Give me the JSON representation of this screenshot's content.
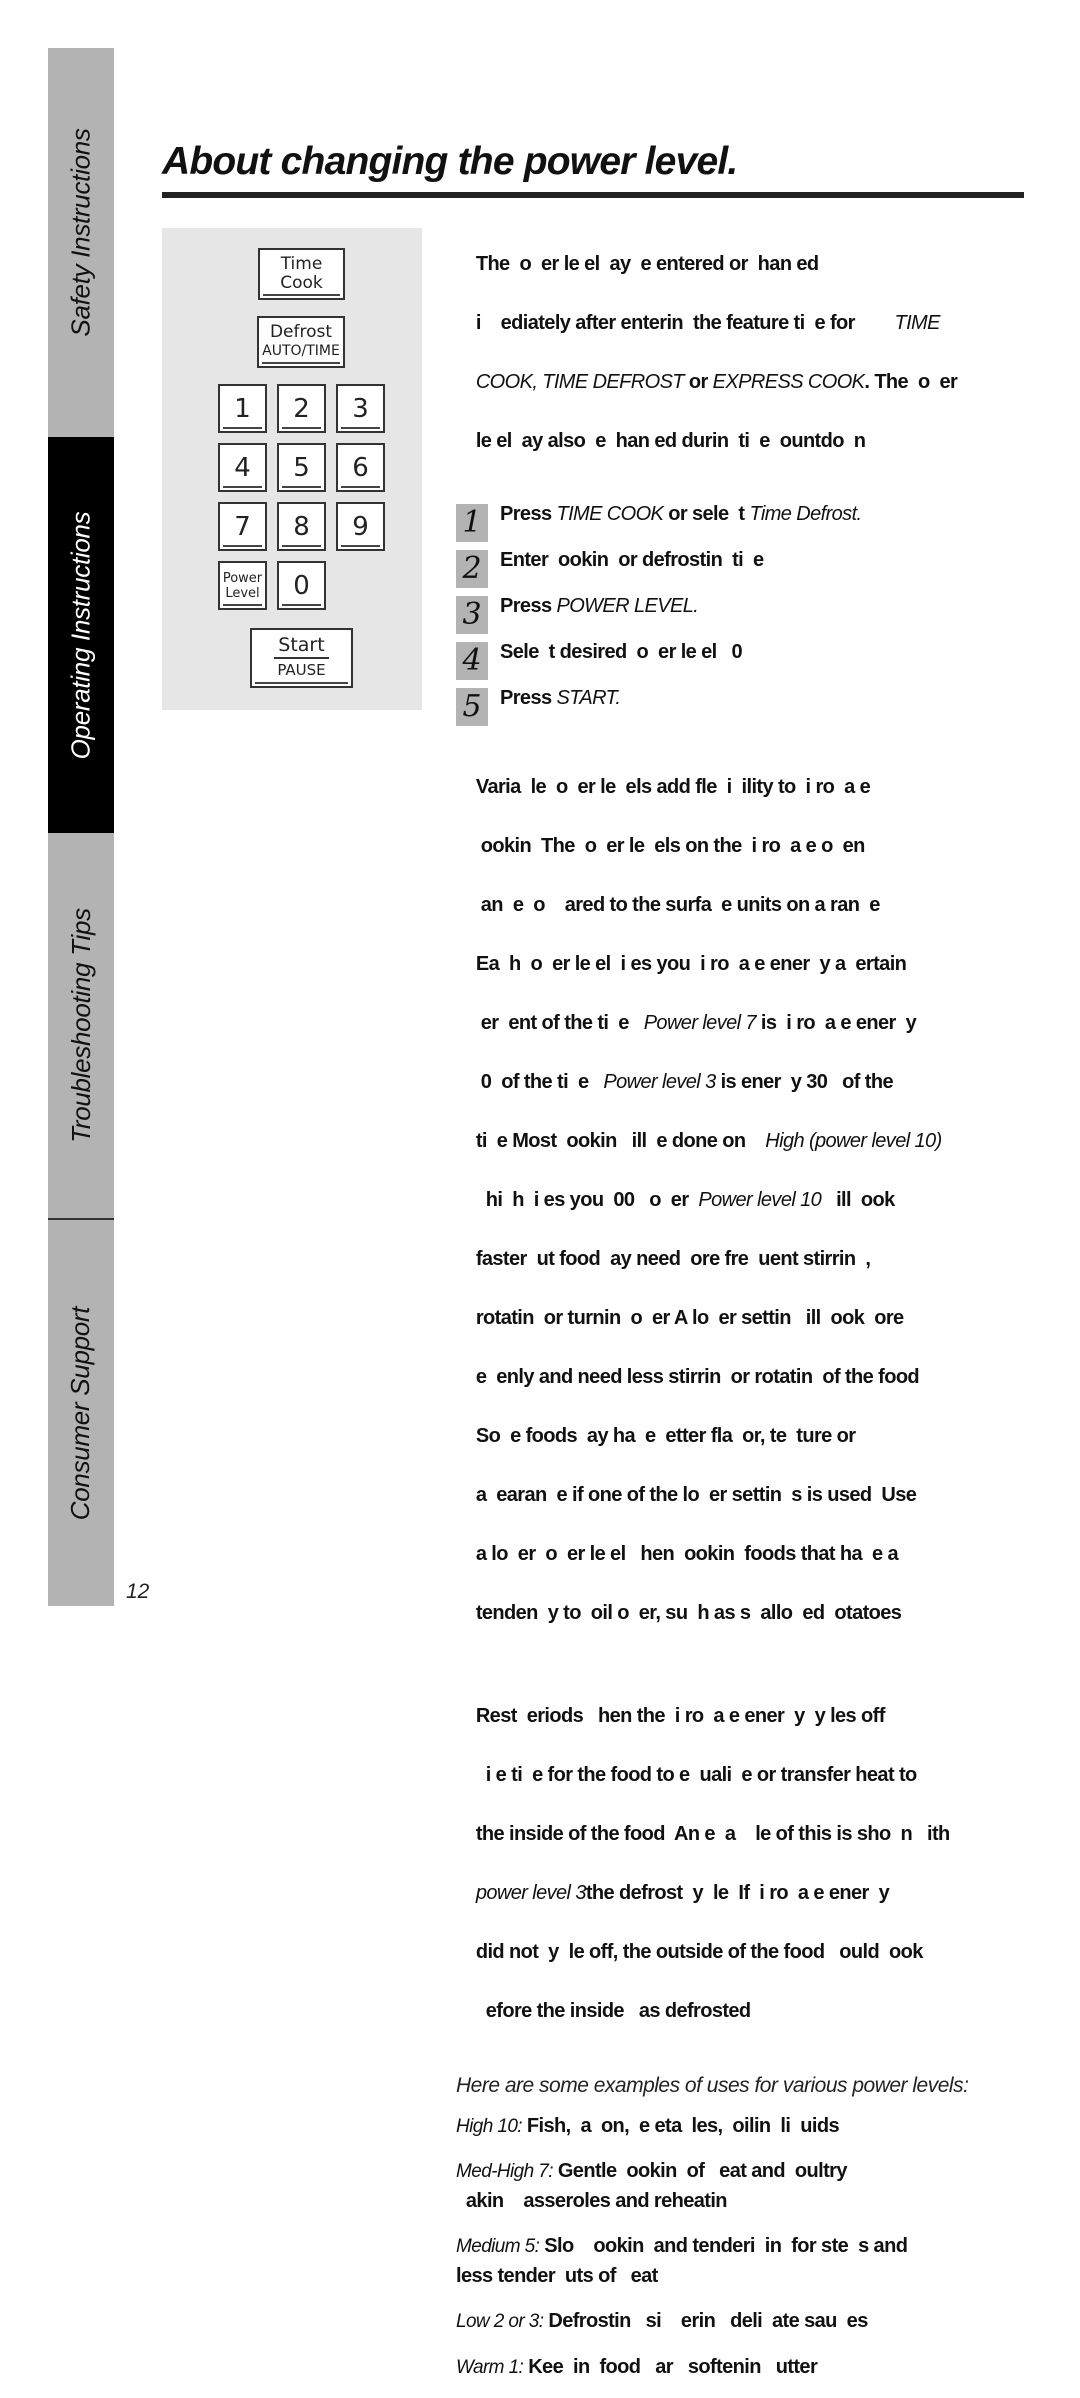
{
  "sidebar": {
    "tabs": [
      {
        "label": "Safety Instructions",
        "active": false
      },
      {
        "label": "Operating Instructions",
        "active": true
      },
      {
        "label": "Troubleshooting Tips",
        "active": false
      },
      {
        "label": "Consumer Support",
        "active": false
      }
    ]
  },
  "page_number": "12",
  "title": "About changing the power level.",
  "keypad": {
    "time_cook": [
      "Time",
      "Cook"
    ],
    "defrost": [
      "Defrost",
      "AUTO/TIME"
    ],
    "digits": [
      "1",
      "2",
      "3",
      "4",
      "5",
      "6",
      "7",
      "8",
      "9",
      "0"
    ],
    "power_level": [
      "Power",
      "Level"
    ],
    "start_pause": [
      "Start",
      "PAUSE"
    ]
  },
  "intro": [
    {
      "t": "The  o  er le el  ay  e entered or  han ed"
    },
    {
      "t": "i    ediately after enterin  the feature ti  e for        ",
      "i": "TIME"
    },
    {
      "i1": "COOK, TIME DEFROST",
      "t1": " or ",
      "i2": "EXPRESS COOK",
      "t2": ". The  o  er"
    },
    {
      "t": "le el  ay also  e  han ed durin  ti  e  ountdo  n"
    }
  ],
  "steps": [
    {
      "num": "1",
      "text": "Press ",
      "italic": "TIME COOK",
      "text2": " or sele  t ",
      "italic2": "Time Defrost."
    },
    {
      "num": "2",
      "text": "Enter  ookin  or defrostin  ti  e"
    },
    {
      "num": "3",
      "text": "Press ",
      "italic": "POWER LEVEL."
    },
    {
      "num": "4",
      "text": "Sele  t desired  o  er le el   0"
    },
    {
      "num": "5",
      "text": "Press ",
      "italic": "START."
    }
  ],
  "para_variable": [
    "Varia  le  o  er le  els add fle  i  ility to  i ro  a e",
    " ookin  The  o  er le  els on the  i ro  a e o  en",
    " an  e  o    ared to the surfa  e units on a ran  e",
    "Ea  h  o  er le el  i es you  i ro  a e ener  y a  ertain",
    " er  ent of the ti  e   ",
    " 0  of the ti  e   ",
    "ti  e Most  ookin   ill  e done on    ",
    "  hi  h  i es you  00   o  er  ",
    "faster  ut food  ay need  ore fre  uent stirrin  ,",
    "rotatin  or turnin  o  er A lo  er settin   ill  ook  ore",
    "e  enly and need less stirrin  or rotatin  of the food",
    "So  e foods  ay ha  e  etter fla  or, te  ture or",
    "a  earan  e if one of the lo  er settin  s is used  Use",
    "a lo  er  o  er le el   hen  ookin  foods that ha  e a",
    "tenden  y to  oil o  er, su  h as s  allo  ed  otatoes"
  ],
  "inline_italics": {
    "pl7": "Power level 7",
    "pl7_after": " is  i ro  a e ener  y",
    "pl3": "Power level 3",
    "pl3_after": " is ener  y 30   of the",
    "high": "High (power level 10)",
    "pl10": "Power level 10",
    "pl10_after": "   ill  ook"
  },
  "para_rest": [
    "Rest  eriods   hen the  i ro  a e ener  y  y les off",
    "  i e ti  e for the food to e  uali  e or transfer heat to",
    "the inside of the food  An e  a    le of this is sho  n   ith",
    {
      "i": "power level 3",
      "t": "the defrost  y  le  If  i ro  a e ener  y"
    },
    "did not  y  le off, the outside of the food   ould  ook",
    "  efore the inside   as defrosted"
  ],
  "examples_intro": "Here are some examples of uses for various power levels:",
  "examples": [
    {
      "label": "High 10:",
      "text": " Fish,  a  on,  e eta  les,  oilin  li  uids"
    },
    {
      "label": "Med-High 7:",
      "text": " Gentle  ookin  of   eat and  oultry",
      "text2": "  akin    asseroles and reheatin"
    },
    {
      "label": "Medium 5:",
      "text": " Slo    ookin  and tenderi  in  for ste  s and",
      "text2": "less tender  uts of   eat"
    },
    {
      "label": "Low 2 or 3:",
      "text": " Defrostin   si    erin   deli  ate sau  es"
    },
    {
      "label": "Warm 1:",
      "text": " Kee  in  food   ar   softenin   utter"
    }
  ]
}
